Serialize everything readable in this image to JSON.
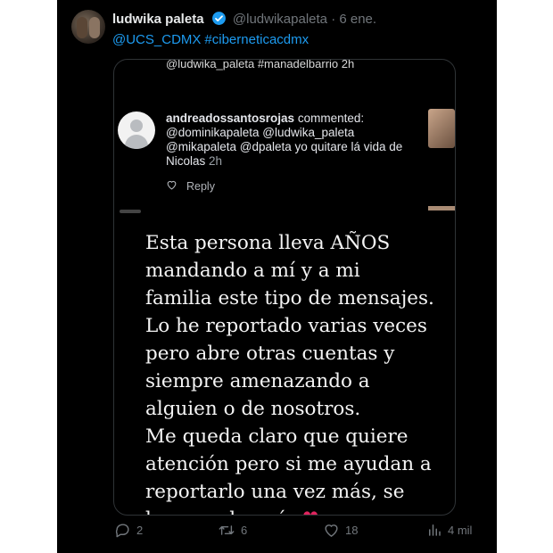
{
  "tweet": {
    "display_name": "ludwika paleta",
    "handle": "@ludwikapaleta",
    "date": "· 6 ene.",
    "mentions": [
      "@UCS_CDMX",
      "#ciberneticacdmx"
    ]
  },
  "media": {
    "cut_text": "@ludwika_paleta #manadelbarrio 2h",
    "comment": {
      "username": "andreadossantosrojas",
      "action": "commented:",
      "lines": [
        "@dominikapaleta @ludwika_paleta",
        "@mikapaleta @dpaleta yo quitare lá vida de",
        "Nicolas"
      ],
      "time": "2h",
      "reply_label": "Reply"
    },
    "story_lines": [
      "Esta persona lleva AÑOS",
      "mandando a mí y a mi",
      "familia este tipo de mensajes.",
      "Lo he reportado varias veces",
      "pero abre otras cuentas y",
      "siempre amenazando a",
      "alguien o de nosotros.",
      "Me queda claro que quiere",
      "atención pero si me ayudan a",
      "reportarlo una vez más, se",
      "los agradecería."
    ],
    "heart_emoji": "♥"
  },
  "actions": {
    "replies": "2",
    "retweets": "6",
    "likes": "18",
    "views": "4 mil"
  },
  "colors": {
    "background": "#000000",
    "text": "#e7e9ea",
    "secondary": "#71767b",
    "link": "#1d9bf0",
    "verified": "#1d9bf0",
    "heart": "#e0245e"
  },
  "icons": [
    "verified-badge-icon",
    "comment-icon",
    "retweet-icon",
    "like-icon",
    "views-icon",
    "heart-outline-icon"
  ]
}
